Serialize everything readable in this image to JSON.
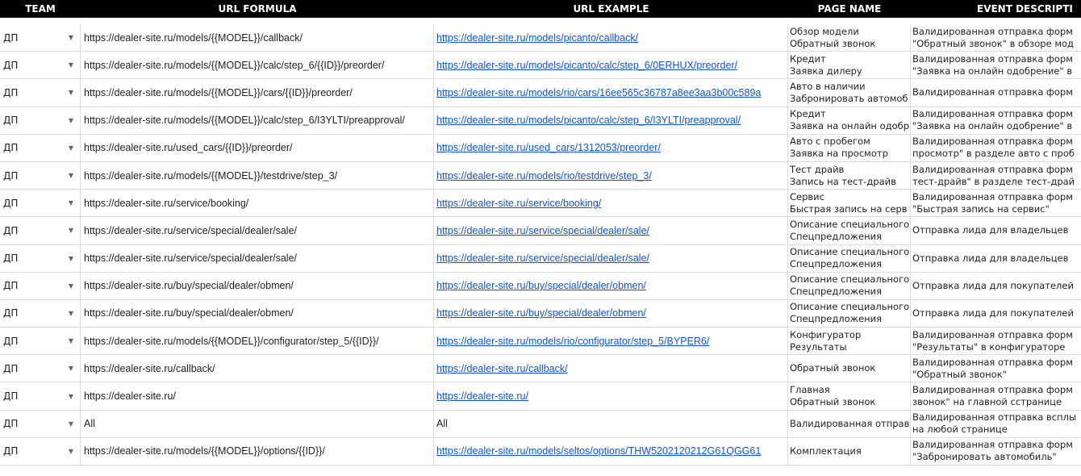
{
  "headers": [
    "TEAM",
    "URL FORMULA",
    "URL EXAMPLE",
    "PAGE NAME",
    "EVENT DESCRIPTI"
  ],
  "colors": {
    "header_bg": "#000000",
    "link": "#1155cc",
    "grid": "#dcdcdc"
  },
  "rows": [
    {
      "team": "ДП",
      "formula": "https://dealer-site.ru/models/{{MODEL}}/callback/",
      "example": "https://dealer-site.ru/models/picanto/callback/",
      "example_is_link": true,
      "page_line1": "Обзор модели",
      "page_line2": "Обратный звонок",
      "event_line1": "Валидированная отправка форм",
      "event_line2": "\"Обратный звонок\" в обзоре мод"
    },
    {
      "team": "ДП",
      "formula": "https://dealer-site.ru/models/{{MODEL}}/calc/step_6/{{ID}}/preorder/",
      "example": "https://dealer-site.ru/models/picanto/calc/step_6/0ERHUX/preorder/",
      "example_is_link": true,
      "page_line1": "Кредит",
      "page_line2": "Заявка дилеру",
      "event_line1": "Валидированная отправка форм",
      "event_line2": "\"Заявка на онлайн одобрение\" в"
    },
    {
      "team": "ДП",
      "formula": "https://dealer-site.ru/models/{{MODEL}}/cars/{{ID}}/preorder/",
      "example": "https://dealer-site.ru/models/rio/cars/16ee565c36787a8ee3aa3b00c589a",
      "example_is_link": true,
      "page_line1": "Авто в наличии",
      "page_line2": "Забронировать автомоб",
      "event_line1": "Валидированная отправка форм",
      "event_line2": ""
    },
    {
      "team": "ДП",
      "formula": "https://dealer-site.ru/models/{{MODEL}}/calc/step_6/I3YLTI/preapproval/",
      "example": "https://dealer-site.ru/models/picanto/calc/step_6/I3YLTI/preapproval/",
      "example_is_link": true,
      "page_line1": "Кредит",
      "page_line2": "Заявка на онлайн одобр",
      "event_line1": "Валидированная отправка форм",
      "event_line2": "\"Заявка на онлайн одобрение\" в"
    },
    {
      "team": "ДП",
      "formula": "https://dealer-site.ru/used_cars/{{ID}}/preorder/",
      "example": "https://dealer-site.ru/used_cars/1312053/preorder/",
      "example_is_link": true,
      "page_line1": "Авто с пробегом",
      "page_line2": "Заявка на просмотр",
      "event_line1": "Валидированная отправка форм",
      "event_line2": "просмотр\" в разделе авто с проб"
    },
    {
      "team": "ДП",
      "formula": "https://dealer-site.ru/models/{{MODEL}}/testdrive/step_3/",
      "example": "https://dealer-site.ru/models/rio/testdrive/step_3/",
      "example_is_link": true,
      "page_line1": "Тест драйв",
      "page_line2": "Запись на тест-драйв",
      "event_line1": "Валидированная отправка форм",
      "event_line2": "тест-драйв\" в разделе тест-драй"
    },
    {
      "team": "ДП",
      "formula": "https://dealer-site.ru/service/booking/",
      "example": "https://dealer-site.ru/service/booking/",
      "example_is_link": true,
      "page_line1": "Сервис",
      "page_line2": "Быстрая запись на серв",
      "event_line1": "Валидированная отправка форм",
      "event_line2": "\"Быстрая запись на сервис\""
    },
    {
      "team": "ДП",
      "formula": "https://dealer-site.ru/service/special/dealer/sale/",
      "example": "https://dealer-site.ru/service/special/dealer/sale/",
      "example_is_link": true,
      "page_line1": "Описание специального",
      "page_line2": "Спецпредложения",
      "event_line1": "Отправка лида для владельцев",
      "event_line2": ""
    },
    {
      "team": "ДП",
      "formula": "https://dealer-site.ru/service/special/dealer/sale/",
      "example": "https://dealer-site.ru/service/special/dealer/sale/",
      "example_is_link": true,
      "page_line1": "Описание специального",
      "page_line2": "Спецпредложения",
      "event_line1": "Отправка лида для владельцев",
      "event_line2": ""
    },
    {
      "team": "ДП",
      "formula": "https://dealer-site.ru/buy/special/dealer/obmen/",
      "example": "https://dealer-site.ru/buy/special/dealer/obmen/",
      "example_is_link": true,
      "page_line1": "Описание специального",
      "page_line2": "Спецпредложения",
      "event_line1": "Отправка лида для покупателей",
      "event_line2": ""
    },
    {
      "team": "ДП",
      "formula": "https://dealer-site.ru/buy/special/dealer/obmen/",
      "example": "https://dealer-site.ru/buy/special/dealer/obmen/",
      "example_is_link": true,
      "page_line1": "Описание специального",
      "page_line2": "Спецпредложения",
      "event_line1": "Отправка лида для покупателей",
      "event_line2": ""
    },
    {
      "team": "ДП",
      "formula": "https://dealer-site.ru/models/{{MODEL}}/configurator/step_5/{{ID}}/",
      "example": "https://dealer-site.ru/models/rio/configurator/step_5/BYPER6/",
      "example_is_link": true,
      "page_line1": "Конфигуратор",
      "page_line2": "Результаты",
      "event_line1": "Валидированная отправка форм",
      "event_line2": "\"Результаты\" в конфигураторе"
    },
    {
      "team": "ДП",
      "formula": "https://dealer-site.ru/callback/",
      "example": "https://dealer-site.ru/callback/",
      "example_is_link": true,
      "page_line1": "Обратный звонок",
      "page_line2": "",
      "event_line1": "Валидированная отправка форм",
      "event_line2": "\"Обратный звонок\""
    },
    {
      "team": "ДП",
      "formula": "https://dealer-site.ru/",
      "example": "https://dealer-site.ru/",
      "example_is_link": true,
      "page_line1": "Главная",
      "page_line2": "Обратный звонок",
      "event_line1": "Валидированная отправка форм",
      "event_line2": "звонок\" на главной сстранице"
    },
    {
      "team": "ДП",
      "formula": "All",
      "example": "All",
      "example_is_link": false,
      "page_line1": "Валидированная отправ",
      "page_line2": "",
      "event_line1": "Валидированная отправка всплы",
      "event_line2": "на любой странице"
    },
    {
      "team": "ДП",
      "formula": "https://dealer-site.ru/models/{{MODEL}}/options/{{ID}}/",
      "example": "https://dealer-site.ru/models/seltos/options/THW5202120212G61QGG61",
      "example_is_link": true,
      "page_line1": "Комплектация",
      "page_line2": "",
      "event_line1": "Валидированная отправка форм",
      "event_line2": "\"Забронировать автомобиль\""
    }
  ]
}
